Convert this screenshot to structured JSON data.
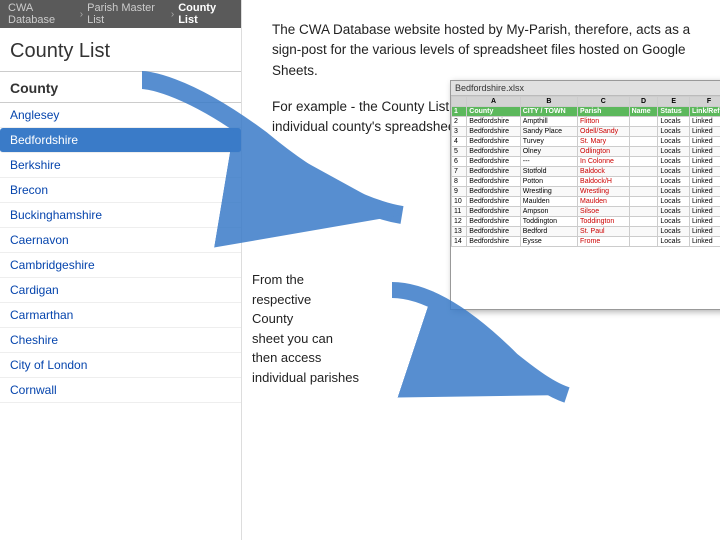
{
  "breadcrumb": {
    "items": [
      "CWA Database",
      "Parish Master List"
    ],
    "current": "County List"
  },
  "page": {
    "title": "County List",
    "section_header": "County"
  },
  "counties": [
    {
      "name": "Anglesey",
      "selected": false
    },
    {
      "name": "Bedfordshire",
      "selected": true
    },
    {
      "name": "Berkshire",
      "selected": false
    },
    {
      "name": "Brecon",
      "selected": false
    },
    {
      "name": "Buckinghamshire",
      "selected": false
    },
    {
      "name": "Caernavon",
      "selected": false
    },
    {
      "name": "Cambridgeshire",
      "selected": false
    },
    {
      "name": "Cardigan",
      "selected": false
    },
    {
      "name": "Carmarthan",
      "selected": false
    },
    {
      "name": "Cheshire",
      "selected": false
    },
    {
      "name": "City of London",
      "selected": false
    },
    {
      "name": "Cornwall",
      "selected": false
    }
  ],
  "description": {
    "para1": "The CWA Database website hosted by My-Parish, therefore, acts as a sign-post for the various levels of spreadsheet files hosted on Google Sheets.",
    "para2": "For example - the County List page provides direct links to each individual county's spreadsheet."
  },
  "from_text": {
    "line1": "From the",
    "line2": "respective",
    "line3": "County",
    "line4": "sheet you can",
    "line5": "then access",
    "line6": "individual parishes"
  },
  "spreadsheet": {
    "title": "Bedfordshire.xlsx",
    "col_headers": [
      "",
      "A",
      "B",
      "C",
      "D",
      "E",
      "F"
    ],
    "header_row": [
      "1",
      "County",
      "CITY / TOWN / VILLAGE",
      "Parish",
      "Status",
      "Link/Reference"
    ],
    "rows": [
      [
        "2",
        "Bedfordshire",
        "Ampthill",
        "Flitton",
        "Locals",
        "Linked"
      ],
      [
        "3",
        "Bedfordshire",
        "Sandy Place",
        "Odell/Sandy",
        "Locals",
        "Linked"
      ],
      [
        "4",
        "Bedfordshire",
        "Turvey",
        "St. Mary",
        "Locals",
        "Linked"
      ],
      [
        "5",
        "Bedfordshire",
        "Olney",
        "Odlington",
        "Locals",
        "Linked"
      ],
      [
        "6",
        "Bedfordshire",
        "---",
        "In Colonne",
        "Locals",
        "Linked"
      ],
      [
        "7",
        "Bedfordshire",
        "Stotfold",
        "Baldock",
        "Locals",
        "Linked"
      ],
      [
        "8",
        "Bedfordshire",
        "Potton",
        "Baldock or Hinton",
        "Locals",
        "Linked"
      ],
      [
        "9",
        "Bedfordshire",
        "Wrestlingworth",
        "Wrestlingworth",
        "Locals",
        "Linked"
      ],
      [
        "10",
        "Bedfordshire",
        "Maulden",
        "Maulden",
        "Locals",
        "Linked"
      ],
      [
        "11",
        "Bedfordshire",
        "Ampson",
        "Silsoe/Ampthill",
        "Locals",
        "Linked"
      ],
      [
        "12",
        "Bedfordshire",
        "Toddington",
        "Toddington",
        "Locals",
        "Linked"
      ],
      [
        "13",
        "Bedfordshire",
        "Bedford",
        "St. Paul",
        "Locals",
        "Linked"
      ],
      [
        "14",
        "Bedfordshire",
        "Eysse",
        "Frome",
        "Locals",
        "Linked"
      ]
    ]
  }
}
